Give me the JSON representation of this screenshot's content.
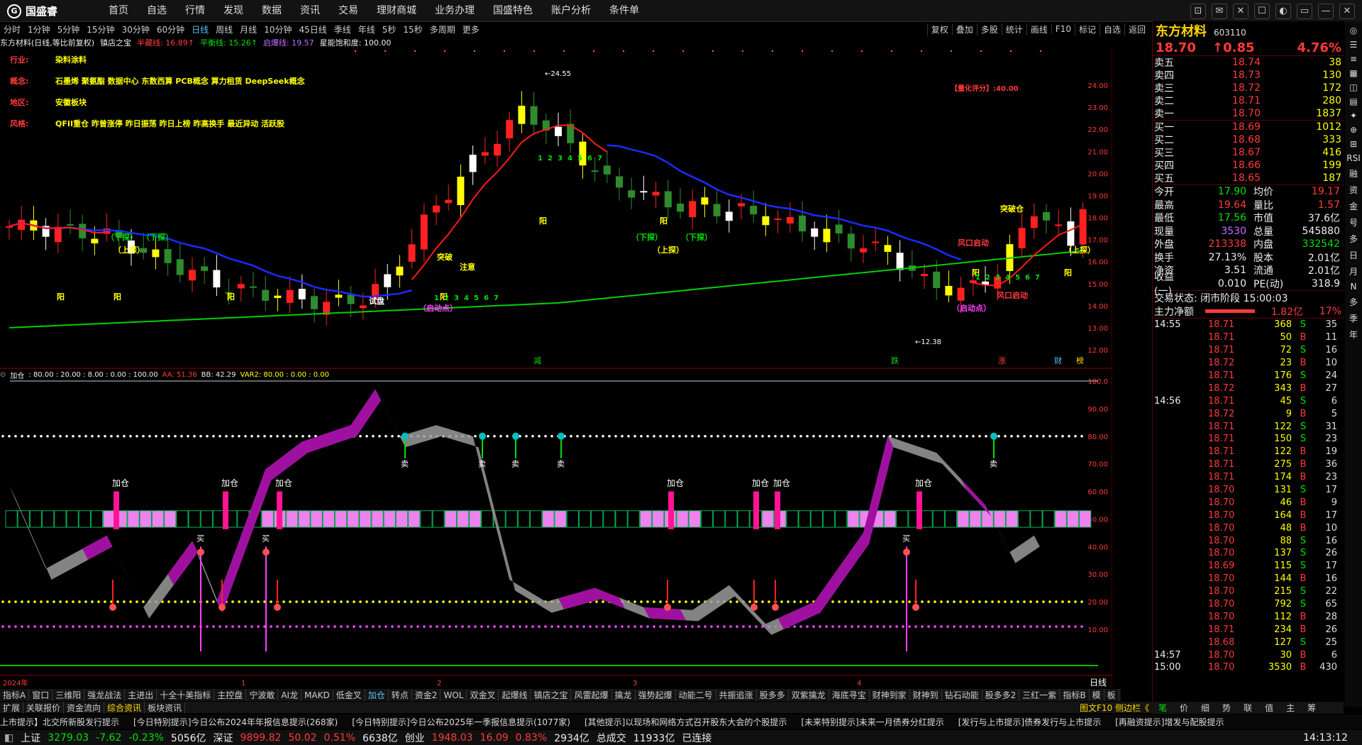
{
  "app": {
    "logo": "国盛睿"
  },
  "menu": [
    "首页",
    "自选",
    "行情",
    "发现",
    "数据",
    "资讯",
    "交易",
    "理财商城",
    "业务办理",
    "国盛特色",
    "账户分析",
    "条件单"
  ],
  "window_buttons": [
    "⊡",
    "✉",
    "✕",
    "☐",
    "◐",
    "▭",
    "—",
    "✕"
  ],
  "periods": [
    "分时",
    "1分钟",
    "5分钟",
    "15分钟",
    "30分钟",
    "60分钟",
    "日线",
    "周线",
    "月线",
    "10分钟",
    "45日线",
    "季线",
    "年线",
    "5秒",
    "15秒",
    "多周期",
    "更多"
  ],
  "period_active": "日线",
  "toolbar": [
    "复权",
    "叠加",
    "多股",
    "统计",
    "画线",
    "F10",
    "标记",
    "自选",
    "返回"
  ],
  "chart_header": {
    "stock": "东方材料(日线,等比前复权)",
    "indicator": "镇店之宝",
    "half_line": "半藏线: 16.89↑",
    "balance_line": "平衡线: 15.26↑",
    "launch_line": "启爆线: 19.57",
    "saturation": "星能饱和度: 100.00"
  },
  "info": [
    {
      "k": "行业:",
      "v": "染料涂料"
    },
    {
      "k": "概念:",
      "v": "石墨烯 聚氨酯 数据中心 东数西算 PCB概念 算力租赁 DeepSeek概念"
    },
    {
      "k": "地区:",
      "v": "安徽板块"
    },
    {
      "k": "风格:",
      "v": "QFII重仓 昨曾涨停 昨日振荡 昨日上榜 昨高换手 最近异动 活跃股"
    }
  ],
  "quant_score": "【量化评分】:40.00",
  "price_labels": {
    "high": "24.55",
    "low": "12.38"
  },
  "y_axis_top": [
    "24.00",
    "23.00",
    "22.00",
    "21.00",
    "20.00",
    "19.00",
    "18.00",
    "17.00",
    "16.00",
    "15.00",
    "14.00",
    "13.00",
    "12.00"
  ],
  "y_axis_bottom": [
    "100.0",
    "90.00",
    "80.00",
    "70.00",
    "60.00",
    "50.00",
    "40.00",
    "30.00",
    "20.00",
    "10.00"
  ],
  "indicator_header": {
    "name": "加仓",
    "params": ": 80.00 : 20.00 : 8.00 : 0.00 : 100.00",
    "aa": "AA: 51.36",
    "bb": "BB: 42.29",
    "var2": "VAR2: 80.00 : 0.00 : 0.00"
  },
  "x_axis": [
    "2024年",
    "1",
    "2",
    "3",
    "4"
  ],
  "x_axis_right": "日线",
  "event_marks": [
    "减",
    "跌",
    "涨",
    "财",
    "榜"
  ],
  "chart_annotations": {
    "tag_add": "加仓",
    "tag_sell": "卖",
    "tag_buy": "买",
    "tag_sun": "阳",
    "tag_down": "（下探）",
    "tag_up": "（上探）",
    "tag_break": "突破",
    "tag_attention": "注意",
    "tag_wind": "风口启动",
    "tag_start": "（启动点）",
    "tag_break_chip": "突破仓",
    "tag_try": "试盘"
  },
  "stock_panel": {
    "name": "东方材料",
    "code": "603110",
    "price": "18.70",
    "change": "↑0.85",
    "pct": "4.76%",
    "sells": [
      {
        "l": "卖五",
        "p": "18.74",
        "q": "38"
      },
      {
        "l": "卖四",
        "p": "18.73",
        "q": "130"
      },
      {
        "l": "卖三",
        "p": "18.72",
        "q": "172"
      },
      {
        "l": "卖二",
        "p": "18.71",
        "q": "280"
      },
      {
        "l": "卖一",
        "p": "18.70",
        "q": "1837"
      }
    ],
    "buys": [
      {
        "l": "买一",
        "p": "18.69",
        "q": "1012"
      },
      {
        "l": "买二",
        "p": "18.68",
        "q": "333"
      },
      {
        "l": "买三",
        "p": "18.67",
        "q": "416"
      },
      {
        "l": "买四",
        "p": "18.66",
        "q": "199"
      },
      {
        "l": "买五",
        "p": "18.65",
        "q": "187"
      }
    ],
    "stats": [
      {
        "a": "今开",
        "b": "17.90",
        "bc": "green",
        "c": "均价",
        "d": "19.17",
        "dc": "red"
      },
      {
        "a": "最高",
        "b": "19.64",
        "bc": "red",
        "c": "量比",
        "d": "1.57",
        "dc": "red"
      },
      {
        "a": "最低",
        "b": "17.56",
        "bc": "green",
        "c": "市值",
        "d": "37.6亿",
        "dc": "white"
      },
      {
        "a": "现量",
        "b": "3530",
        "bc": "purple",
        "c": "总量",
        "d": "545880",
        "dc": "white"
      },
      {
        "a": "外盘",
        "b": "213338",
        "bc": "red",
        "c": "内盘",
        "d": "332542",
        "dc": "green"
      },
      {
        "a": "换手",
        "b": "27.13%",
        "bc": "white",
        "c": "股本",
        "d": "2.01亿",
        "dc": "white"
      },
      {
        "a": "净资",
        "b": "3.51",
        "bc": "white",
        "c": "流通",
        "d": "2.01亿",
        "dc": "white"
      },
      {
        "a": "收益(一)",
        "b": "0.010",
        "bc": "white",
        "c": "PE(动)",
        "d": "318.9",
        "dc": "white"
      }
    ],
    "trade_status": "交易状态: 闭市阶段 15:00:03",
    "main_net_label": "主力净额",
    "main_net": "1.82亿",
    "main_net_pct": "17%",
    "ticks": [
      {
        "t": "14:55",
        "p": "18.71",
        "v": "368",
        "s": "S",
        "n": "35"
      },
      {
        "t": "",
        "p": "18.71",
        "v": "50",
        "s": "B",
        "n": "11"
      },
      {
        "t": "",
        "p": "18.71",
        "v": "72",
        "s": "S",
        "n": "16"
      },
      {
        "t": "",
        "p": "18.72",
        "v": "23",
        "s": "B",
        "n": "10"
      },
      {
        "t": "",
        "p": "18.71",
        "v": "176",
        "s": "S",
        "n": "24"
      },
      {
        "t": "",
        "p": "18.72",
        "v": "343",
        "s": "B",
        "n": "27"
      },
      {
        "t": "14:56",
        "p": "18.71",
        "v": "45",
        "s": "S",
        "n": "6"
      },
      {
        "t": "",
        "p": "18.72",
        "v": "9",
        "s": "B",
        "n": "5"
      },
      {
        "t": "",
        "p": "18.71",
        "v": "122",
        "s": "S",
        "n": "31"
      },
      {
        "t": "",
        "p": "18.71",
        "v": "150",
        "s": "S",
        "n": "23"
      },
      {
        "t": "",
        "p": "18.71",
        "v": "122",
        "s": "B",
        "n": "19"
      },
      {
        "t": "",
        "p": "18.71",
        "v": "275",
        "s": "B",
        "n": "36"
      },
      {
        "t": "",
        "p": "18.71",
        "v": "174",
        "s": "B",
        "n": "23"
      },
      {
        "t": "",
        "p": "18.70",
        "v": "131",
        "s": "S",
        "n": "17"
      },
      {
        "t": "",
        "p": "18.70",
        "v": "46",
        "s": "B",
        "n": "9"
      },
      {
        "t": "",
        "p": "18.70",
        "v": "164",
        "s": "B",
        "n": "17"
      },
      {
        "t": "",
        "p": "18.70",
        "v": "48",
        "s": "B",
        "n": "10"
      },
      {
        "t": "",
        "p": "18.70",
        "v": "88",
        "s": "S",
        "n": "16"
      },
      {
        "t": "",
        "p": "18.70",
        "v": "137",
        "s": "S",
        "n": "26"
      },
      {
        "t": "",
        "p": "18.69",
        "v": "115",
        "s": "S",
        "n": "17"
      },
      {
        "t": "",
        "p": "18.70",
        "v": "144",
        "s": "B",
        "n": "16"
      },
      {
        "t": "",
        "p": "18.70",
        "v": "215",
        "s": "S",
        "n": "22"
      },
      {
        "t": "",
        "p": "18.70",
        "v": "792",
        "s": "S",
        "n": "65"
      },
      {
        "t": "",
        "p": "18.70",
        "v": "112",
        "s": "B",
        "n": "28"
      },
      {
        "t": "",
        "p": "18.71",
        "v": "234",
        "s": "B",
        "n": "26"
      },
      {
        "t": "",
        "p": "18.68",
        "v": "127",
        "s": "S",
        "n": "25"
      },
      {
        "t": "14:57",
        "p": "18.70",
        "v": "30",
        "s": "B",
        "n": "6"
      },
      {
        "t": "15:00",
        "p": "18.70",
        "v": "3530",
        "s": "B",
        "n": "430"
      }
    ]
  },
  "side_vertical": [
    "◎",
    "☰",
    "≡",
    "▦",
    "◫",
    "▤",
    "✦",
    "⊕",
    "⊞",
    "RSI",
    "融",
    "资",
    "金",
    "号",
    "多",
    "日",
    "月",
    "N",
    "多",
    "季",
    "年"
  ],
  "tabs_row1": [
    "指标A",
    "窗口",
    "三维阳",
    "强龙战法",
    "主进出",
    "十全十美指标",
    "主控盘",
    "宁波敢",
    "AI龙",
    "MAKD",
    "低金叉",
    "加仓",
    "转点",
    "资金2",
    "WOL",
    "双金叉",
    "起爆线",
    "镇店之宝",
    "风雷起爆",
    "擒龙",
    "强势起爆",
    "动能二号",
    "共振追涨",
    "股多多",
    "双紫擒龙",
    "海底寻宝",
    "财神到家",
    "财神到",
    "钻石动能",
    "股多多2",
    "三红一紫",
    "指标B",
    "模",
    "板"
  ],
  "tabs_row1_active": "加仓",
  "tabs_row2": [
    "扩展",
    "关联报价",
    "资金流向",
    "综合资讯",
    "板块资讯"
  ],
  "tabs_row2_right": "图文F10 侧边栏《",
  "rp_tabs": [
    "笔",
    "价",
    "细",
    "势",
    "联",
    "值",
    "主",
    "筹"
  ],
  "ticker": [
    "上市提示】北交所新股发行提示",
    "[今日特别提示]今日公布2024年年报信息提示(268家)",
    "[今日特别提示]今日公布2025年一季报信息提示(1077家)",
    "[其他提示]以现场和网络方式召开股东大会的个股提示",
    "[未来特别提示]未来一月债券分红提示",
    "[发行与上市提示]债券发行与上市提示",
    "[再融资提示]增发与配股提示"
  ],
  "status": [
    {
      "label": "上证",
      "v1": "3279.03",
      "v2": "-7.62",
      "v3": "-0.23%",
      "v4": "5056亿",
      "color": "green"
    },
    {
      "label": "深证",
      "v1": "9899.82",
      "v2": "50.02",
      "v3": "0.51%",
      "v4": "6638亿",
      "color": "red"
    },
    {
      "label": "创业",
      "v1": "1948.03",
      "v2": "16.09",
      "v3": "0.83%",
      "v4": "2934亿",
      "color": "red"
    }
  ],
  "total_label": "总成交",
  "total_value": "11933亿",
  "connected": "已连接",
  "clock": "14:13:12",
  "colors": {
    "red": "#ff3a3a",
    "green": "#00e000",
    "blue": "#1a2bff",
    "magenta": "#b000b0",
    "pink": "#ee82ee",
    "yellow": "#ffff00"
  }
}
